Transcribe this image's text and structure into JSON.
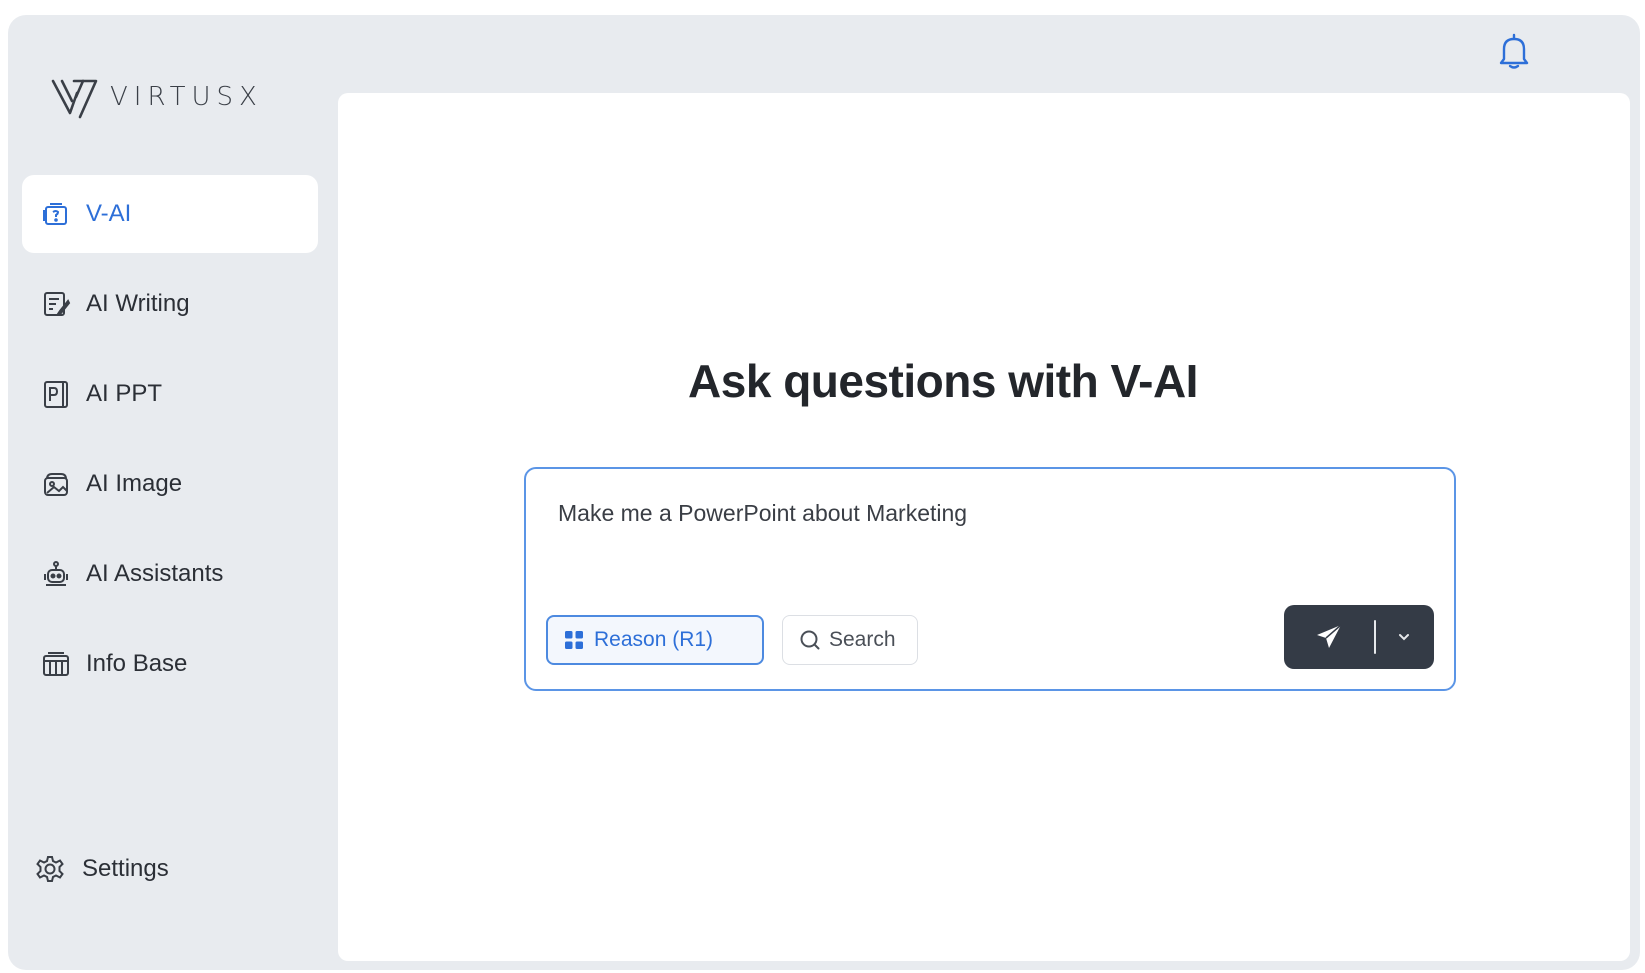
{
  "brand": {
    "name": "VIRTUSX"
  },
  "sidebar": {
    "items": [
      {
        "label": "V-AI",
        "icon": "chat-window-icon",
        "active": true
      },
      {
        "label": "AI Writing",
        "icon": "document-pen-icon",
        "active": false
      },
      {
        "label": "AI PPT",
        "icon": "presentation-icon",
        "active": false
      },
      {
        "label": "AI Image",
        "icon": "image-icon",
        "active": false
      },
      {
        "label": "AI Assistants",
        "icon": "robot-icon",
        "active": false
      },
      {
        "label": "Info Base",
        "icon": "database-icon",
        "active": false
      }
    ],
    "settings_label": "Settings"
  },
  "header": {
    "notifications_icon": "bell-icon"
  },
  "main": {
    "title": "Ask questions with V-AI",
    "composer": {
      "value": "Make me a PowerPoint about Marketing",
      "reason_label": "Reason (R1)",
      "search_label": "Search"
    }
  },
  "colors": {
    "accent": "#2d6fd8",
    "send_button": "#343b46",
    "sidebar_bg": "#e8ebef"
  }
}
